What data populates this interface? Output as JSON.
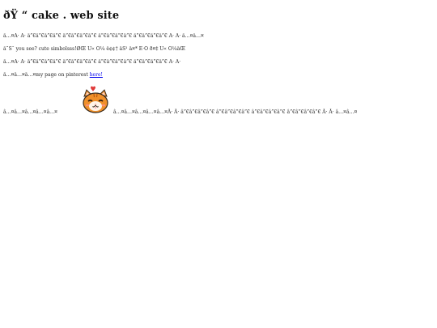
{
  "header": {
    "title": "ðŸ  “ cake . web site"
  },
  "lines": {
    "line1": "â…¤Â· Â· â”€â”€â”€â”€ â”€â”€â”€â”€ â”€â”€â”€â”€ â”€â”€â”€â”€ Â· Â· â…¤â…¤",
    "line2": "â˜Šˆ you see? cute simbolsss!ØŒ Ü« Ò¼ ê¢¢† âŠ¹ â¤* Ë·Ö ð¤‡ Ü« Ò¼âŒ",
    "line3": "â…¤Â· Â· â”€â”€â”€â”€ â”€â”€â”€â”€ â”€â”€â”€â”€ â”€â”€â”€â”€ Â· Â·",
    "line4_prefix": "â…¤â…¤â…¤my page on pinterest ",
    "line4_link": "here!"
  },
  "cat_row": {
    "left_text": "â…¤â…¤â…¤â…¤â…¤",
    "right_text": "â…¤â…¤â…¤â…¤â…¤Â· Â· â”€â”€â”€â”€ â”€â”€â”€â”€ â”€â”€â”€â”€ â”€â”€â”€â”€ Â· Â· â…¤â…¤"
  },
  "colors": {
    "link": "#0000ee",
    "cat_orange": "#f0902a",
    "heart": "#e03a3a"
  },
  "icons": {
    "cat": "cat-face-icon",
    "heart": "heart-icon"
  }
}
